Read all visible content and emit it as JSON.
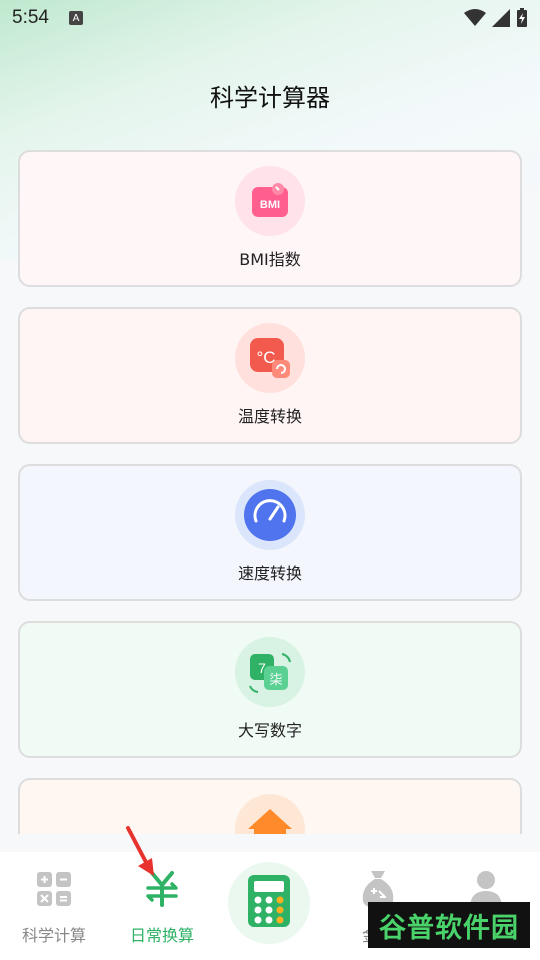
{
  "status_bar": {
    "time": "5:54",
    "indicator": "A"
  },
  "header": {
    "title": "科学计算器"
  },
  "cards": [
    {
      "label": "BMI指数",
      "icon": "bmi-icon",
      "badge_text": "BMI",
      "bg": "#fff6f8",
      "icon_bg": "#ffe2ea"
    },
    {
      "label": "温度转换",
      "icon": "thermometer-celsius-icon",
      "badge_text": "°C",
      "bg": "#fff5f4",
      "icon_bg": "#ffe0dc"
    },
    {
      "label": "速度转换",
      "icon": "speedometer-icon",
      "bg": "#f4f6fd",
      "icon_bg": "#dbe5fb"
    },
    {
      "label": "大写数字",
      "icon": "number-convert-icon",
      "badge_text_1": "7",
      "badge_text_2": "柒",
      "bg": "#f1fbf5",
      "icon_bg": "#d8f2e3"
    },
    {
      "label": "",
      "icon": "rate-house-icon",
      "badge_text": "%",
      "bg": "#fff8f2",
      "icon_bg": "#ffe7d6"
    }
  ],
  "bottom_nav": {
    "items": [
      {
        "label": "科学计算",
        "icon": "calculator-grid-icon",
        "active": false
      },
      {
        "label": "日常换算",
        "icon": "yuan-exchange-icon",
        "active": true
      },
      {
        "label": "",
        "icon": "calculator-icon",
        "active": false
      },
      {
        "label": "金融",
        "icon": "money-bag-icon",
        "active": false
      },
      {
        "label": "",
        "icon": "user-icon",
        "active": false
      }
    ]
  },
  "watermark": "谷普软件园",
  "colors": {
    "accent": "#2fb266",
    "nav_inactive": "#888888"
  }
}
